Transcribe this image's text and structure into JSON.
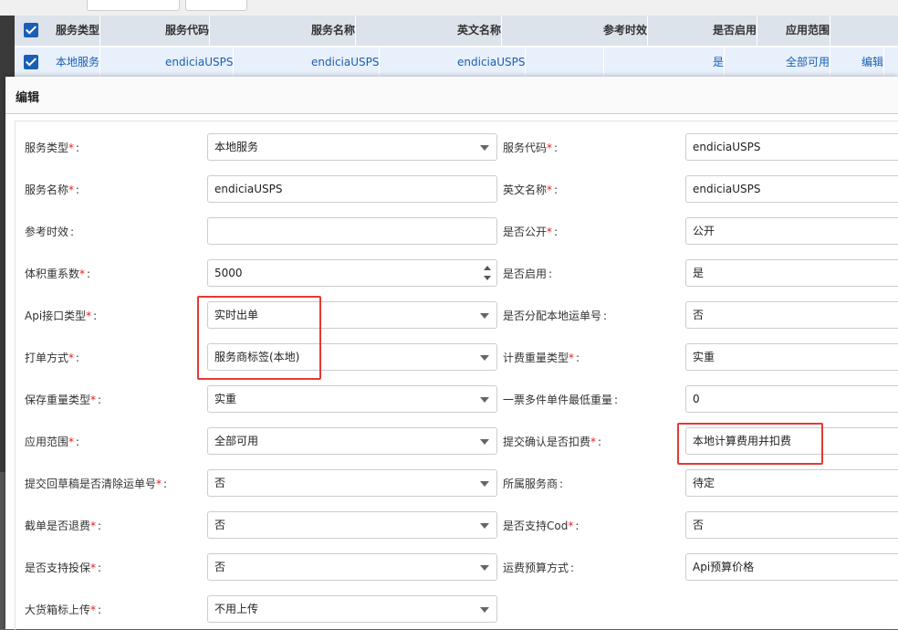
{
  "table": {
    "headers": [
      "服务类型",
      "服务代码",
      "服务名称",
      "英文名称",
      "参考时效",
      "是否启用",
      "应用范围"
    ],
    "row": [
      "本地服务",
      "endiciaUSPS",
      "endiciaUSPS",
      "endiciaUSPS",
      "",
      "是",
      "全部可用"
    ],
    "edit_label": "编辑"
  },
  "dialog": {
    "title": "编辑",
    "required_mark": "*",
    "colon": ":",
    "left_fields": [
      {
        "label": "服务类型",
        "required": true,
        "value": "本地服务",
        "type": "select"
      },
      {
        "label": "服务名称",
        "required": true,
        "value": "endiciaUSPS",
        "type": "text"
      },
      {
        "label": "参考时效",
        "required": false,
        "value": "",
        "type": "text"
      },
      {
        "label": "体积重系数",
        "required": true,
        "value": "5000",
        "type": "number"
      },
      {
        "label": "Api接口类型",
        "required": true,
        "value": "实时出单",
        "type": "select"
      },
      {
        "label": "打单方式",
        "required": true,
        "value": "服务商标签(本地)",
        "type": "select"
      },
      {
        "label": "保存重量类型",
        "required": true,
        "value": "实重",
        "type": "select"
      },
      {
        "label": "应用范围",
        "required": true,
        "value": "全部可用",
        "type": "select"
      },
      {
        "label": "提交回草稿是否清除运单号",
        "required": true,
        "value": "否",
        "type": "select"
      },
      {
        "label": "截单是否退费",
        "required": true,
        "value": "否",
        "type": "select"
      },
      {
        "label": "是否支持投保",
        "required": true,
        "value": "否",
        "type": "select"
      },
      {
        "label": "大货箱标上传",
        "required": true,
        "value": "不用上传",
        "type": "select"
      }
    ],
    "right_fields": [
      {
        "label": "服务代码",
        "required": true,
        "value": "endiciaUSPS"
      },
      {
        "label": "英文名称",
        "required": true,
        "value": "endiciaUSPS"
      },
      {
        "label": "是否公开",
        "required": true,
        "value": "公开"
      },
      {
        "label": "是否启用",
        "required": false,
        "value": "是"
      },
      {
        "label": "是否分配本地运单号",
        "required": false,
        "value": "否"
      },
      {
        "label": "计费重量类型",
        "required": true,
        "value": "实重"
      },
      {
        "label": "一票多件单件最低重量",
        "required": false,
        "value": "0"
      },
      {
        "label": "提交确认是否扣费",
        "required": true,
        "value": "本地计算费用并扣费"
      },
      {
        "label": "所属服务商",
        "required": false,
        "value": "待定"
      },
      {
        "label": "是否支持Cod",
        "required": true,
        "value": "否"
      },
      {
        "label": "运费预算方式",
        "required": false,
        "value": "Api预算价格"
      }
    ]
  }
}
